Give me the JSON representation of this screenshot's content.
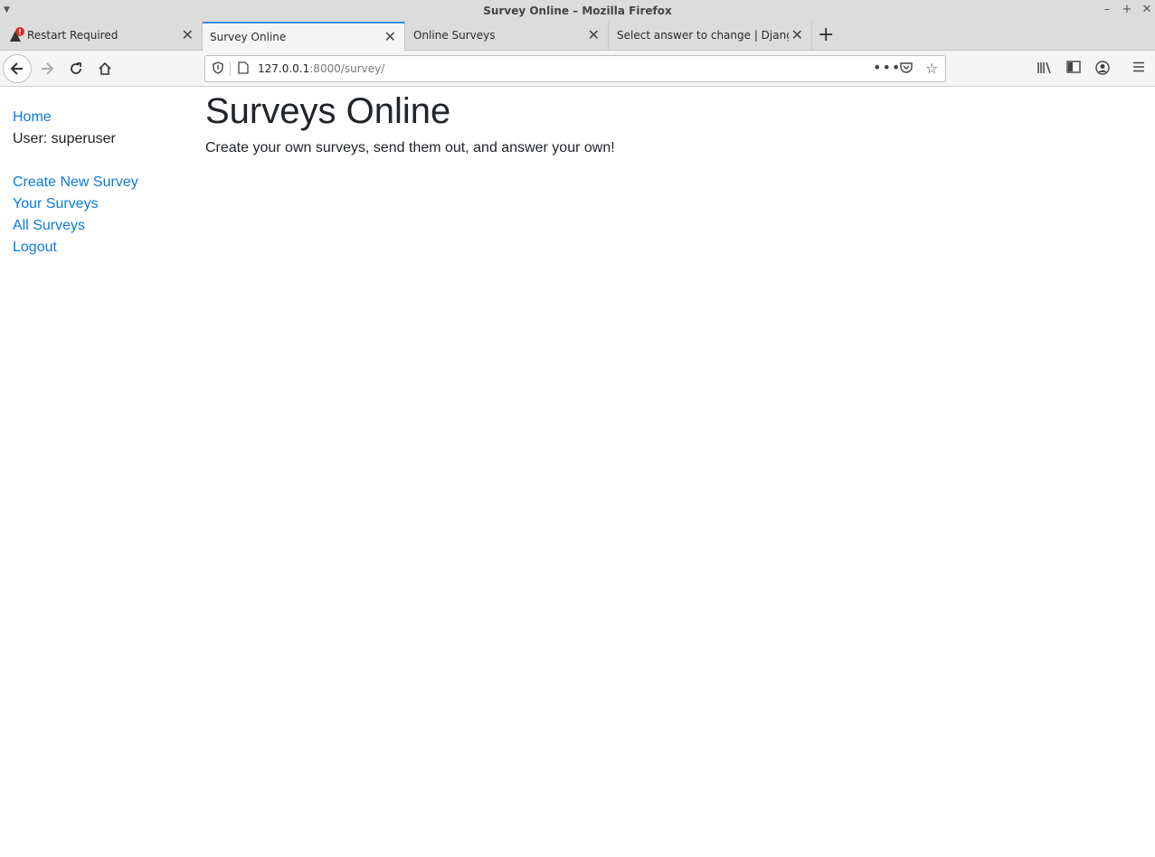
{
  "window": {
    "title": "Survey Online – Mozilla Firefox"
  },
  "tabs": [
    {
      "label": "Restart Required",
      "active": false
    },
    {
      "label": "Survey Online",
      "active": true
    },
    {
      "label": "Online Surveys",
      "active": false
    },
    {
      "label": "Select answer to change | Django",
      "active": false
    }
  ],
  "navbar": {
    "url_host": "127.0.0.1",
    "url_rest": ":8000/survey/"
  },
  "sidebar": {
    "home": "Home",
    "user": "User: superuser",
    "create": "Create New Survey",
    "yours": "Your Surveys",
    "all": "All Surveys",
    "logout": "Logout"
  },
  "main": {
    "title": "Surveys Online",
    "subtitle": "Create your own surveys, send them out, and answer your own!"
  },
  "colors": {
    "link": "#0a7be0",
    "active_tab_accent": "#3b8fe0",
    "warning_badge": "#d92a1c"
  }
}
